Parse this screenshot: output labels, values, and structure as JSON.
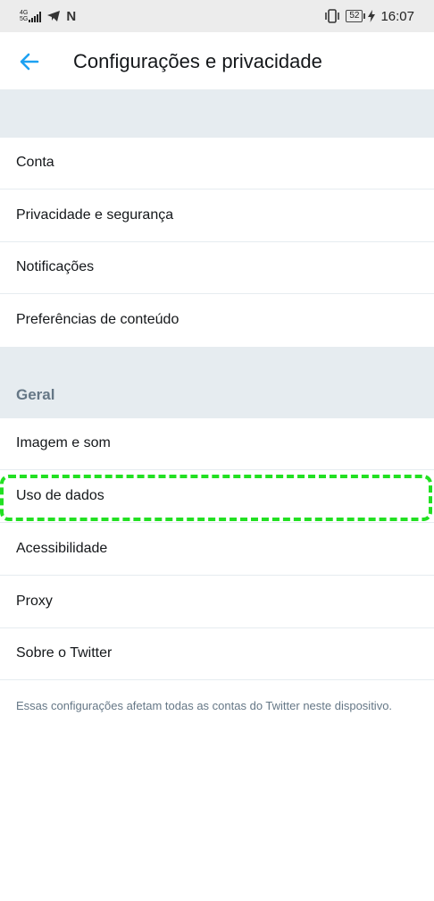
{
  "status_bar": {
    "network": "4G",
    "network_sub": "5G",
    "battery": "52",
    "time": "16:07"
  },
  "header": {
    "title": "Configurações e privacidade"
  },
  "account_items": [
    {
      "label": "Conta"
    },
    {
      "label": "Privacidade e segurança"
    },
    {
      "label": "Notificações"
    },
    {
      "label": "Preferências de conteúdo"
    }
  ],
  "general": {
    "heading": "Geral",
    "items": [
      {
        "label": "Imagem e som"
      },
      {
        "label": "Uso de dados"
      },
      {
        "label": "Acessibilidade"
      },
      {
        "label": "Proxy"
      },
      {
        "label": "Sobre o Twitter"
      }
    ]
  },
  "footer_note": "Essas configurações afetam todas as contas do Twitter neste dispositivo.",
  "colors": {
    "accent": "#1da1f2",
    "highlight": "#22e022",
    "section_bg": "#e6ecf0"
  }
}
